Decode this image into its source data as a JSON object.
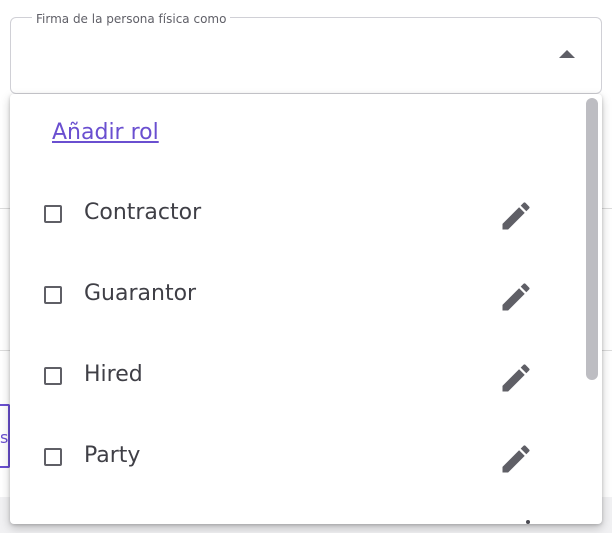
{
  "field": {
    "label": "Firma de la persona física como"
  },
  "dropdown": {
    "add_role_label": "Añadir rol",
    "options": [
      {
        "label": "Contractor",
        "checked": false
      },
      {
        "label": "Guarantor",
        "checked": false
      },
      {
        "label": "Hired",
        "checked": false
      },
      {
        "label": "Party",
        "checked": false
      }
    ]
  },
  "background": {
    "partial_text": "st"
  },
  "icons": {
    "expand": "caret-up-icon",
    "edit": "pencil-icon",
    "checkbox": "checkbox-unchecked-icon"
  },
  "colors": {
    "accent": "#6a4fd0",
    "text": "#3f3f46",
    "icon": "#5f5f66"
  }
}
